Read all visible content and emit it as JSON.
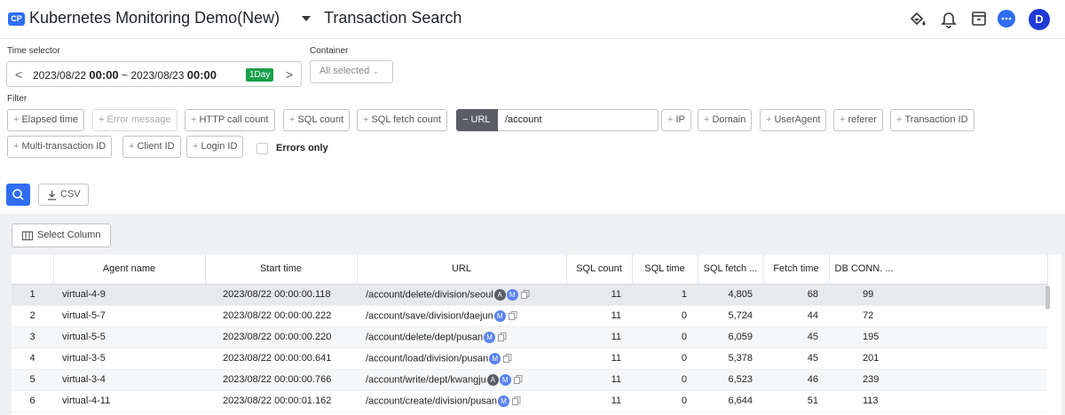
{
  "header": {
    "badge": "CP",
    "project_title": "Kubernetes Monitoring Demo(New)",
    "page_title": "Transaction Search",
    "avatar_letter": "D",
    "icons": [
      "paint-bucket-icon",
      "bell-icon",
      "archive-icon",
      "chat-icon"
    ]
  },
  "time_selector": {
    "label": "Time selector",
    "start_date": "2023/08/22",
    "start_time": "00:00",
    "separator": "~",
    "end_date": "2023/08/23",
    "end_time": "00:00",
    "range_badge": "1Day",
    "prev_arrow": "<",
    "next_arrow": ">"
  },
  "container": {
    "label": "Container",
    "value": "All selected"
  },
  "filter": {
    "label": "Filter",
    "row1": [
      {
        "label": "Elapsed time",
        "disabled": false
      },
      {
        "label": "Error message",
        "disabled": true
      },
      {
        "label": "HTTP call count",
        "disabled": false
      },
      {
        "label": "SQL count",
        "disabled": false
      },
      {
        "label": "SQL fetch count",
        "disabled": false
      }
    ],
    "url_chip": "URL",
    "url_minus": "−",
    "url_value": "/account",
    "row1_after": [
      {
        "label": "IP"
      },
      {
        "label": "Domain"
      },
      {
        "label": "UserAgent"
      },
      {
        "label": "referer"
      },
      {
        "label": "Transaction ID"
      }
    ],
    "row2": [
      {
        "label": "Multi-transaction ID"
      },
      {
        "label": "Client ID"
      },
      {
        "label": "Login ID"
      }
    ],
    "errors_only": "Errors only",
    "plus_sign": "+"
  },
  "actions": {
    "csv_label": "CSV"
  },
  "results": {
    "select_column_label": "Select Column",
    "columns": [
      "",
      "Agent name",
      "Start time",
      "URL",
      "SQL count",
      "SQL time",
      "SQL fetch ...",
      "Fetch time",
      "DB CONN. ..."
    ],
    "rows": [
      {
        "idx": "1",
        "agent": "virtual-4-9",
        "start": "2023/08/22 00:00:00.118",
        "url": "/account/delete/division/seoul",
        "badges": [
          "A",
          "M"
        ],
        "sql_count": "11",
        "sql_time": "1",
        "sql_fetch": "4,805",
        "fetch_time": "68",
        "db_conn": "99"
      },
      {
        "idx": "2",
        "agent": "virtual-5-7",
        "start": "2023/08/22 00:00:00.222",
        "url": "/account/save/division/daejun",
        "badges": [
          "M"
        ],
        "sql_count": "11",
        "sql_time": "0",
        "sql_fetch": "5,724",
        "fetch_time": "44",
        "db_conn": "72"
      },
      {
        "idx": "3",
        "agent": "virtual-5-5",
        "start": "2023/08/22 00:00:00.220",
        "url": "/account/delete/dept/pusan",
        "badges": [
          "M"
        ],
        "sql_count": "11",
        "sql_time": "0",
        "sql_fetch": "6,059",
        "fetch_time": "45",
        "db_conn": "195"
      },
      {
        "idx": "4",
        "agent": "virtual-3-5",
        "start": "2023/08/22 00:00:00.641",
        "url": "/account/load/division/pusan",
        "badges": [
          "M"
        ],
        "sql_count": "11",
        "sql_time": "0",
        "sql_fetch": "5,378",
        "fetch_time": "45",
        "db_conn": "201"
      },
      {
        "idx": "5",
        "agent": "virtual-3-4",
        "start": "2023/08/22 00:00:00.766",
        "url": "/account/write/dept/kwangju",
        "badges": [
          "A",
          "M"
        ],
        "sql_count": "11",
        "sql_time": "0",
        "sql_fetch": "6,523",
        "fetch_time": "46",
        "db_conn": "239"
      },
      {
        "idx": "6",
        "agent": "virtual-4-11",
        "start": "2023/08/22 00:00:01.162",
        "url": "/account/create/division/pusan",
        "badges": [
          "M"
        ],
        "sql_count": "11",
        "sql_time": "0",
        "sql_fetch": "6,644",
        "fetch_time": "51",
        "db_conn": "113"
      }
    ]
  },
  "colors": {
    "accent": "#2f6df6",
    "badge_green": "#19a14b",
    "avatar": "#1f3bd6",
    "chip_active": "#5a5d63"
  }
}
